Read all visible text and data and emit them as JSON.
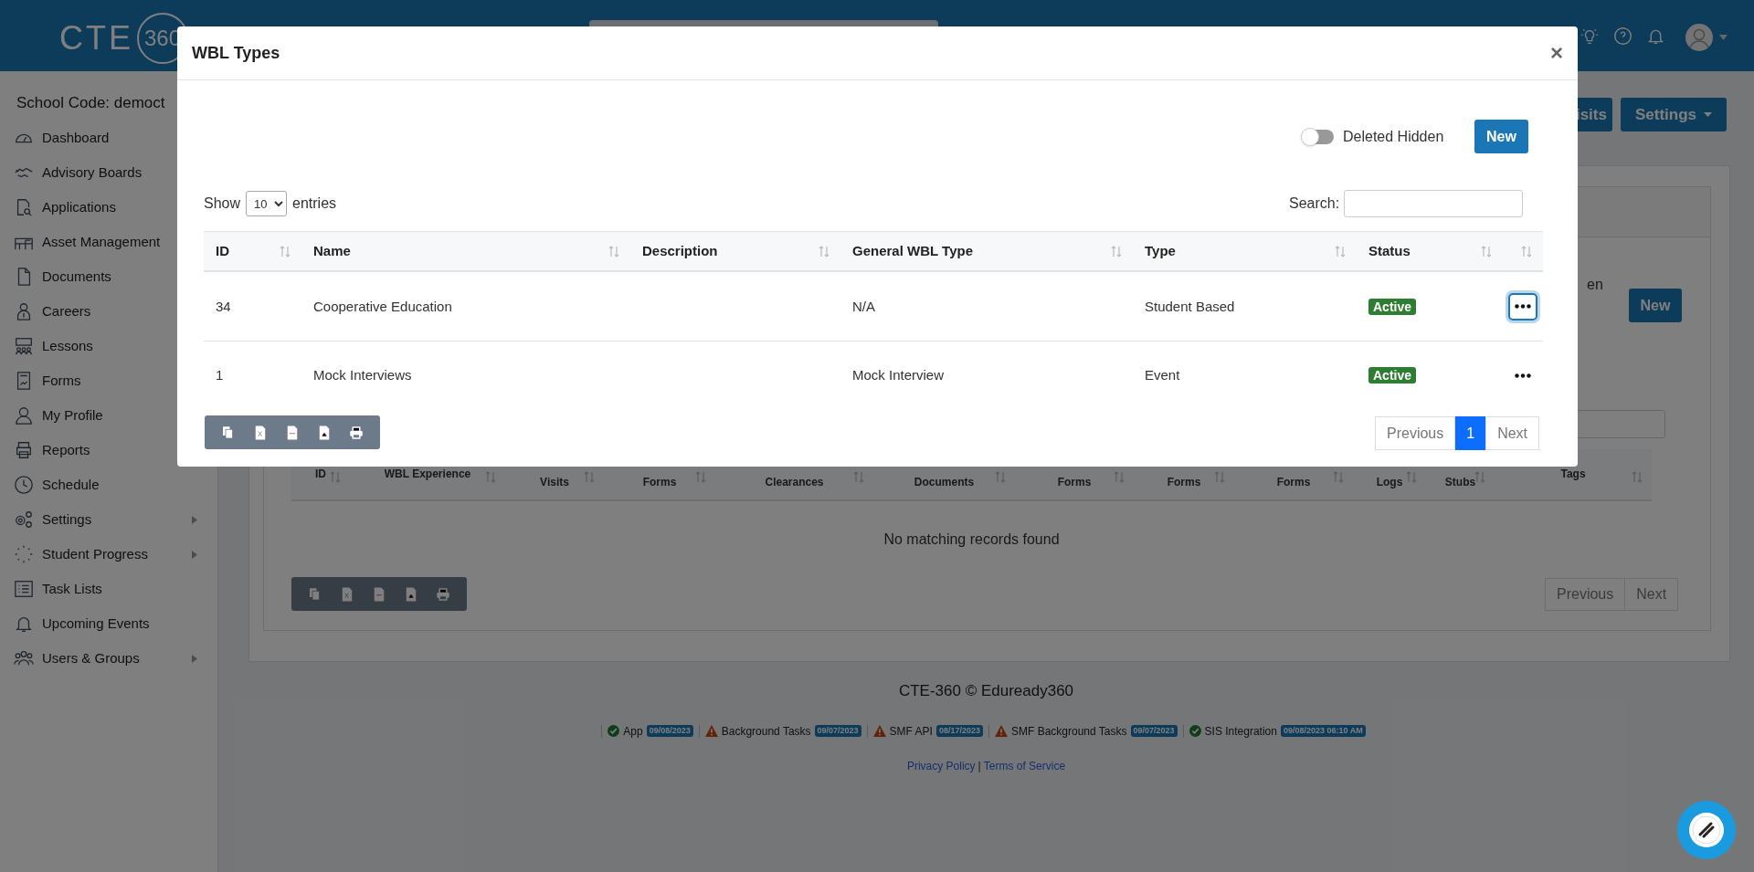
{
  "header": {
    "logo_text": "CTE",
    "logo_circled": "360"
  },
  "sidebar": {
    "school_code": "School Code: democt",
    "items": [
      {
        "label": "Dashboard",
        "has_submenu": false
      },
      {
        "label": "Advisory Boards",
        "has_submenu": false
      },
      {
        "label": "Applications",
        "has_submenu": false
      },
      {
        "label": "Asset Management",
        "has_submenu": false
      },
      {
        "label": "Documents",
        "has_submenu": false
      },
      {
        "label": "Careers",
        "has_submenu": false
      },
      {
        "label": "Lessons",
        "has_submenu": false
      },
      {
        "label": "Forms",
        "has_submenu": false
      },
      {
        "label": "My Profile",
        "has_submenu": false
      },
      {
        "label": "Reports",
        "has_submenu": false
      },
      {
        "label": "Schedule",
        "has_submenu": false
      },
      {
        "label": "Settings",
        "has_submenu": true
      },
      {
        "label": "Student Progress",
        "has_submenu": true
      },
      {
        "label": "Task Lists",
        "has_submenu": false
      },
      {
        "label": "Upcoming Events",
        "has_submenu": false
      },
      {
        "label": "Users & Groups",
        "has_submenu": true
      }
    ]
  },
  "page": {
    "buttons": [
      {
        "label": "isits",
        "caret": false
      },
      {
        "label": "Settings",
        "caret": true
      }
    ],
    "panel": {
      "toggle_label_fragment": "en",
      "new_button": "New",
      "columns": [
        {
          "label": "ID",
          "kind": "single"
        },
        {
          "label": "WBL Experience",
          "kind": "single"
        },
        {
          "label": "Visits",
          "kind": "lower"
        },
        {
          "label": "Forms",
          "kind": "lower"
        },
        {
          "label": "Clearances",
          "kind": "lower"
        },
        {
          "label": "Documents",
          "kind": "lower"
        },
        {
          "label": "Forms",
          "kind": "lower"
        },
        {
          "label": "Forms",
          "kind": "lower"
        },
        {
          "label": "Forms",
          "kind": "lower"
        },
        {
          "label": "Logs",
          "kind": "lower"
        },
        {
          "label": "Stubs",
          "kind": "lower"
        },
        {
          "label": "Tags",
          "kind": "single"
        }
      ],
      "empty_message": "No matching records found",
      "pagination": [
        "Previous",
        "Next"
      ]
    }
  },
  "modal": {
    "title": "WBL Types",
    "close": "×",
    "deleted_toggle": {
      "label": "Deleted Hidden",
      "on": false
    },
    "new_button": "New",
    "length": {
      "before": "Show",
      "value": "10",
      "after": "entries"
    },
    "search_label": "Search:",
    "columns": [
      "ID",
      "Name",
      "Description",
      "General WBL Type",
      "Type",
      "Status"
    ],
    "rows": [
      {
        "id": "34",
        "name": "Cooperative Education",
        "general_type": "N/A",
        "type": "Student Based",
        "status": "Active",
        "focused": true
      },
      {
        "id": "1",
        "name": "Mock Interviews",
        "general_type": "Mock Interview",
        "type": "Event",
        "status": "Active",
        "focused": false
      }
    ],
    "pagination": {
      "previous": "Previous",
      "pages": [
        {
          "label": "1",
          "selected": true
        }
      ],
      "next": "Next"
    }
  },
  "footer": {
    "copyright": "CTE-360 © Eduready360",
    "statuses": [
      {
        "label": "App",
        "date": "09/08/2023",
        "ok": true
      },
      {
        "label": "Background Tasks",
        "date": "09/07/2023",
        "ok": false
      },
      {
        "label": "SMF API",
        "date": "08/17/2023",
        "ok": false
      },
      {
        "label": "SMF Background Tasks",
        "date": "09/07/2023",
        "ok": false
      },
      {
        "label": "SIS Integration",
        "date": "09/08/2023 06:10 AM",
        "ok": true
      }
    ],
    "links": [
      "Privacy Policy",
      "Terms of Service"
    ],
    "link_separator": "|"
  }
}
